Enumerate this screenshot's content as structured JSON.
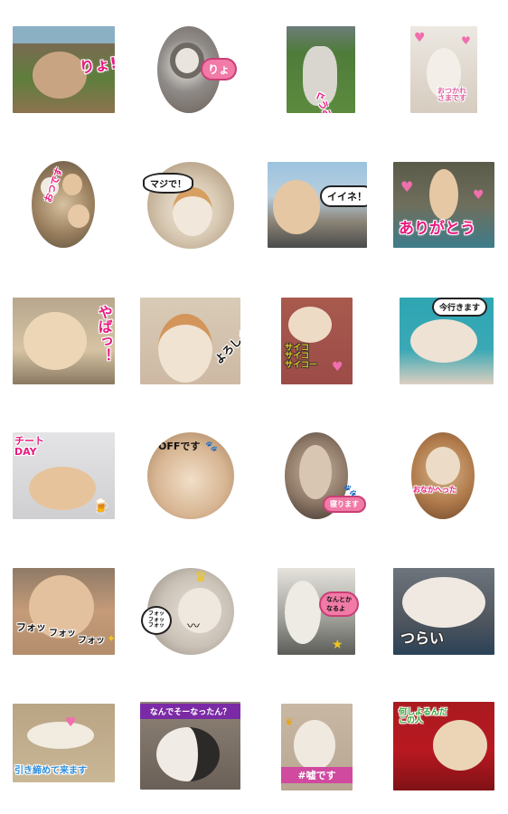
{
  "stickers": [
    {
      "id": "s01",
      "text": "りょ!",
      "text_color": "#e8197f",
      "bg": "#8a7a63"
    },
    {
      "id": "s02",
      "text": "りょ",
      "text_color": "#ffffff",
      "bg": "#b5ab9d"
    },
    {
      "id": "s03",
      "text": "ぐうみぃ",
      "text_color": "#e8197f",
      "bg": "#5a8a3b"
    },
    {
      "id": "s04",
      "text": "おつかれ\nさまです",
      "text_color": "#e05a9e",
      "bg": "#d9d2c8"
    },
    {
      "id": "s05",
      "text": "おつです",
      "text_color": "#e8197f",
      "bg": "#8b7b60"
    },
    {
      "id": "s06",
      "text": "マジで！",
      "text_color": "#111111",
      "bg": "#d4c7b4"
    },
    {
      "id": "s07",
      "text": "イイネ！",
      "text_color": "#111111",
      "bg": "#9fb3c8"
    },
    {
      "id": "s08",
      "text": "ありがとう",
      "text_color": "#e8197f",
      "bg": "#6f6f5a"
    },
    {
      "id": "s09",
      "text": "やばっ！",
      "text_color": "#e8197f",
      "bg": "#cdb48f"
    },
    {
      "id": "s10",
      "text": "よろしく",
      "text_color": "#111111",
      "bg": "#cfb9a5"
    },
    {
      "id": "s11",
      "text": "サイコ\nサイコ\nサイコー",
      "text_color": "#f0c51f",
      "bg": "#9c4b47"
    },
    {
      "id": "s12",
      "text": "今行きます",
      "text_color": "#111111",
      "bg": "#2fa6b3"
    },
    {
      "id": "s13",
      "text": "チート\nDAY",
      "text_color": "#e8197f",
      "bg": "#cfcfd2"
    },
    {
      "id": "s14",
      "text": "OFFです",
      "text_color": "#111111",
      "bg": "#c9a67f"
    },
    {
      "id": "s15",
      "text": "寝ります",
      "text_color": "#ffffff",
      "bg": "#66564a"
    },
    {
      "id": "s16",
      "text": "おなかへった",
      "text_color": "#e8197f",
      "bg": "#b07a4a"
    },
    {
      "id": "s17",
      "text": "フォッ\nフォッ\nフォッ",
      "text_color": "#111111",
      "bg": "#c59b79"
    },
    {
      "id": "s18",
      "text": "フォッ\nフォッ\nフォッ",
      "text_color": "#111111",
      "bg": "#c9c1b6"
    },
    {
      "id": "s19",
      "text": "なんとか\nなるよ",
      "text_color": "#111111",
      "bg": "#9c9d96"
    },
    {
      "id": "s20",
      "text": "つらい",
      "text_color": "#ffffff",
      "bg": "#50565e"
    },
    {
      "id": "s21",
      "text": "引き締めて来ます",
      "text_color": "#2a8ee0",
      "bg": "#c9b796"
    },
    {
      "id": "s22",
      "text": "なんでそーなったん？",
      "text_color": "#ffffff",
      "bg": "#6a6057",
      "band_bg": "#7b2aa5"
    },
    {
      "id": "s23",
      "text": "#嘘です",
      "text_color": "#ffffff",
      "bg": "#b8a691"
    },
    {
      "id": "s24",
      "text": "何しよるんだ\nこの人",
      "text_color": "#2fa72f",
      "bg": "#b91820"
    }
  ]
}
